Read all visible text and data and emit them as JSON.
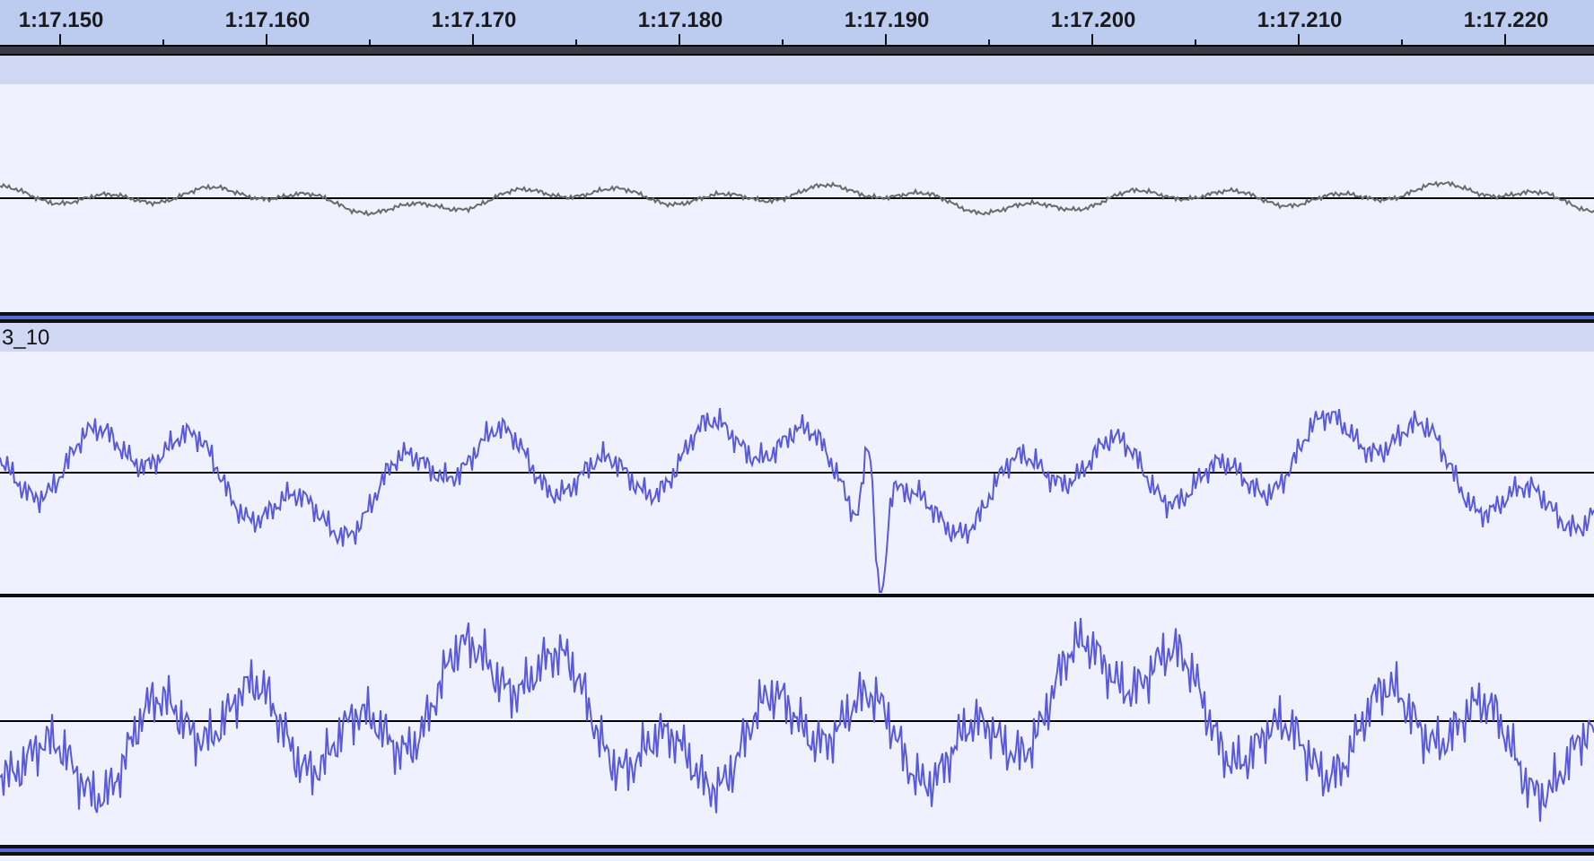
{
  "ruler": {
    "labels": [
      "1:17.150",
      "1:17.160",
      "1:17.170",
      "1:17.180",
      "1:17.190",
      "1:17.200",
      "1:17.210",
      "1:17.220"
    ]
  },
  "tracks": [
    {
      "kind": "mono"
    },
    {
      "kind": "stereo",
      "name": "3_10"
    }
  ]
}
